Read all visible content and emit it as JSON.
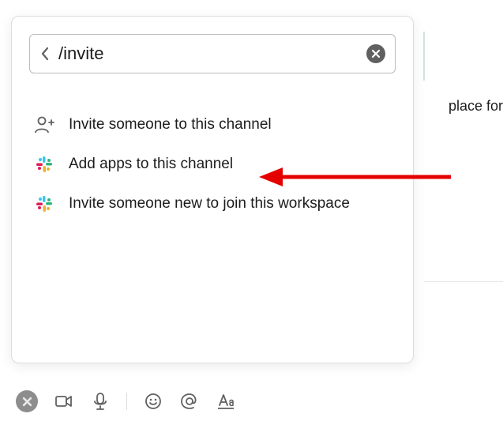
{
  "background": {
    "partial_text": "place for"
  },
  "search": {
    "value": "/invite"
  },
  "results": [
    {
      "icon": "person-add",
      "label": "Invite someone to this channel"
    },
    {
      "icon": "slack",
      "label": "Add apps to this channel"
    },
    {
      "icon": "slack",
      "label": "Invite someone new to join this workspace"
    }
  ],
  "annotation": {
    "target_index": 1
  },
  "toolbar": {
    "items": [
      "close",
      "video",
      "mic",
      "divider",
      "emoji",
      "mention",
      "format"
    ]
  }
}
